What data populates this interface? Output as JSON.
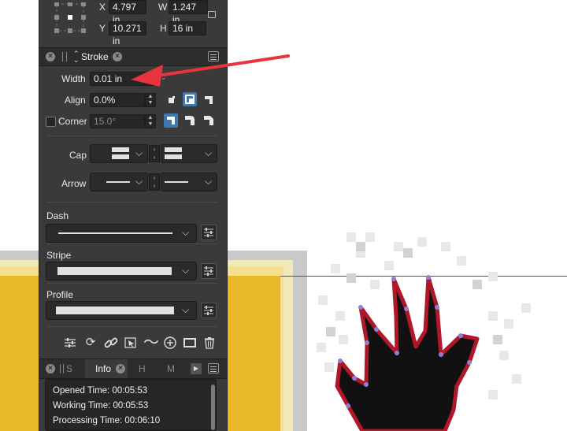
{
  "transform": {
    "x_label": "X",
    "x_value": "4.797 in",
    "w_label": "W",
    "w_value": "1.247 in",
    "y_label": "Y",
    "y_value": "10.271 in",
    "h_label": "H",
    "h_value": "16 in"
  },
  "stroke_tab": {
    "title": "Stroke",
    "width_label": "Width",
    "width_value": "0.01 in",
    "align_label": "Align",
    "align_value": "0.0%",
    "corner_label": "Corner",
    "corner_value": "15.0°",
    "cap_label": "Cap",
    "arrow_label": "Arrow",
    "dash_label": "Dash",
    "stripe_label": "Stripe",
    "profile_label": "Profile"
  },
  "info_tabs": {
    "tab_s": "S",
    "tab_info": "Info",
    "tab_h": "H",
    "tab_m": "M"
  },
  "info": {
    "opened": "Opened Time: 00:05:53",
    "working": "Working Time: 00:05:53",
    "processing": "Processing Time: 00:06:10"
  },
  "colors": {
    "panel": "#3a3a3a",
    "selected": "#3e78b0",
    "arrow": "#e8343f",
    "yellow": "#e8b82a",
    "outline": "#b0182a"
  },
  "icons": [
    "settings-sliders-icon",
    "rotate-icon",
    "link-icon",
    "selection-icon",
    "wave-icon",
    "plus-circle-icon",
    "rectangle-icon",
    "trash-icon"
  ]
}
